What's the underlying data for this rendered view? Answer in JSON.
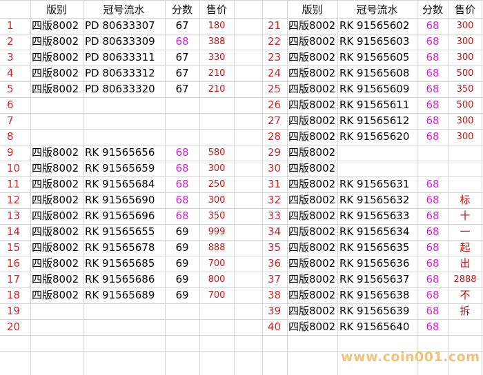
{
  "headers": {
    "version": "版别",
    "serial": "冠号流水",
    "score": "分数",
    "price": "售价"
  },
  "left_rows": [
    {
      "n": "1",
      "version": "四版8002",
      "serial": "PD 80633307",
      "score": "67",
      "price": "180"
    },
    {
      "n": "2",
      "version": "四版8002",
      "serial": "PD 80633309",
      "score": "68",
      "price": "388"
    },
    {
      "n": "3",
      "version": "四版8002",
      "serial": "PD 80633311",
      "score": "67",
      "price": "330"
    },
    {
      "n": "4",
      "version": "四版8002",
      "serial": "PD 80633312",
      "score": "67",
      "price": "210"
    },
    {
      "n": "5",
      "version": "四版8002",
      "serial": "PD 80633320",
      "score": "67",
      "price": "210"
    },
    {
      "n": "6",
      "version": "",
      "serial": "",
      "score": "",
      "price": ""
    },
    {
      "n": "7",
      "version": "",
      "serial": "",
      "score": "",
      "price": ""
    },
    {
      "n": "8",
      "version": "",
      "serial": "",
      "score": "",
      "price": ""
    },
    {
      "n": "9",
      "version": "四版8002",
      "serial": "RK 91565656",
      "score": "68",
      "price": "580"
    },
    {
      "n": "10",
      "version": "四版8002",
      "serial": "RK 91565659",
      "score": "68",
      "price": "300"
    },
    {
      "n": "11",
      "version": "四版8002",
      "serial": "RK 91565684",
      "score": "68",
      "price": "250"
    },
    {
      "n": "12",
      "version": "四版8002",
      "serial": "RK 91565690",
      "score": "68",
      "price": "300"
    },
    {
      "n": "13",
      "version": "四版8002",
      "serial": "RK 91565696",
      "score": "68",
      "price": "350"
    },
    {
      "n": "14",
      "version": "四版8002",
      "serial": "RK 91565655",
      "score": "69",
      "price": "999"
    },
    {
      "n": "15",
      "version": "四版8002",
      "serial": "RK 91565678",
      "score": "69",
      "price": "888"
    },
    {
      "n": "16",
      "version": "四版8002",
      "serial": "RK 91565685",
      "score": "69",
      "price": "700"
    },
    {
      "n": "17",
      "version": "四版8002",
      "serial": "RK 91565686",
      "score": "69",
      "price": "800"
    },
    {
      "n": "18",
      "version": "四版8002",
      "serial": "RK 91565689",
      "score": "69",
      "price": "700"
    },
    {
      "n": "19",
      "version": "",
      "serial": "",
      "score": "",
      "price": ""
    },
    {
      "n": "20",
      "version": "",
      "serial": "",
      "score": "",
      "price": ""
    }
  ],
  "right_rows": [
    {
      "n": "21",
      "version": "四版8002",
      "serial": "RK 91565602",
      "score": "68",
      "price": "300"
    },
    {
      "n": "22",
      "version": "四版8002",
      "serial": "RK 91565603",
      "score": "68",
      "price": "300"
    },
    {
      "n": "23",
      "version": "四版8002",
      "serial": "RK 91565605",
      "score": "68",
      "price": "300"
    },
    {
      "n": "24",
      "version": "四版8002",
      "serial": "RK 91565608",
      "score": "68",
      "price": "500"
    },
    {
      "n": "25",
      "version": "四版8002",
      "serial": "RK 91565609",
      "score": "68",
      "price": "350"
    },
    {
      "n": "26",
      "version": "四版8002",
      "serial": "RK 91565611",
      "score": "68",
      "price": "500"
    },
    {
      "n": "27",
      "version": "四版8002",
      "serial": "RK 91565612",
      "score": "68",
      "price": "300"
    },
    {
      "n": "28",
      "version": "四版8002",
      "serial": "RK 91565620",
      "score": "68",
      "price": "300"
    },
    {
      "n": "29",
      "version": "四版8002",
      "serial": "",
      "score": "",
      "price": ""
    },
    {
      "n": "30",
      "version": "四版8002",
      "serial": "",
      "score": "",
      "price": ""
    },
    {
      "n": "31",
      "version": "四版8002",
      "serial": "RK 91565631",
      "score": "68",
      "price": ""
    },
    {
      "n": "32",
      "version": "四版8002",
      "serial": "RK 91565632",
      "score": "68",
      "price": "标"
    },
    {
      "n": "33",
      "version": "四版8002",
      "serial": "RK 91565633",
      "score": "68",
      "price": "十"
    },
    {
      "n": "34",
      "version": "四版8002",
      "serial": "RK 91565634",
      "score": "68",
      "price": "一"
    },
    {
      "n": "35",
      "version": "四版8002",
      "serial": "RK 91565635",
      "score": "68",
      "price": "起"
    },
    {
      "n": "36",
      "version": "四版8002",
      "serial": "RK 91565636",
      "score": "68",
      "price": "出"
    },
    {
      "n": "37",
      "version": "四版8002",
      "serial": "RK 91565637",
      "score": "68",
      "price": "2888"
    },
    {
      "n": "38",
      "version": "四版8002",
      "serial": "RK 91565638",
      "score": "68",
      "price": "不"
    },
    {
      "n": "39",
      "version": "四版8002",
      "serial": "RK 91565639",
      "score": "68",
      "price": "拆"
    },
    {
      "n": "40",
      "version": "四版8002",
      "serial": "RK 91565640",
      "score": "68",
      "price": ""
    }
  ],
  "watermark": "www.coin001.com",
  "colors": {
    "row_number": "#e02020",
    "score_pink": "#e020e0",
    "price": "#d01010",
    "watermark": "#f3c27a"
  }
}
